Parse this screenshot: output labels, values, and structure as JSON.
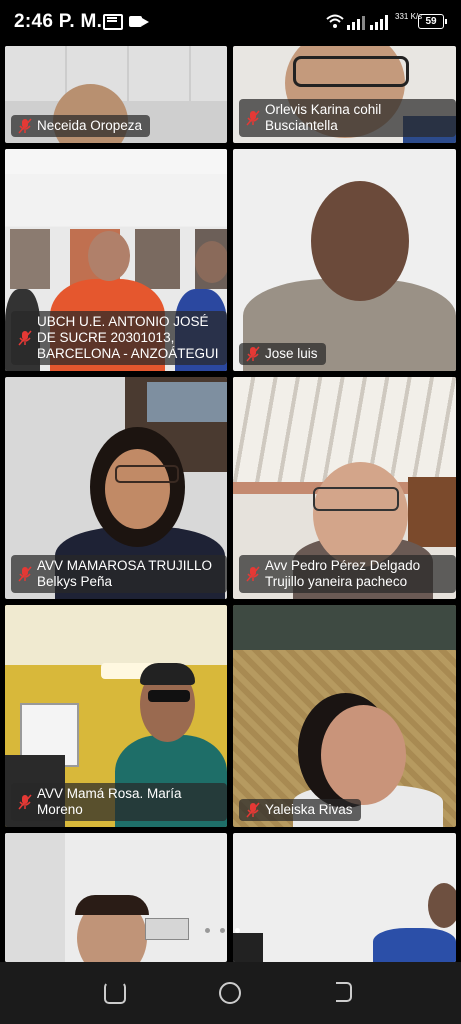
{
  "status_bar": {
    "time": "2:46 P. M.",
    "network_speed": "331 K/s",
    "battery": "59"
  },
  "participants": [
    {
      "name": "Neceida Oropeza",
      "muted": true
    },
    {
      "name": "Orlevis Karina cohil Busciantella",
      "muted": true
    },
    {
      "name": "UBCH U.E. ANTONIO JOSÉ DE SUCRE 20301013, BARCELONA - ANZOÁTEGUI",
      "muted": true
    },
    {
      "name": "Jose luis",
      "muted": true
    },
    {
      "name": "AVV MAMAROSA TRUJILLO Belkys Peña",
      "muted": true
    },
    {
      "name": "Avv Pedro Pérez Delgado Trujillo yaneira pacheco",
      "muted": true
    },
    {
      "name": "AVV Mamá Rosa. María Moreno",
      "muted": true
    },
    {
      "name": "Yaleiska Rivas",
      "muted": true
    },
    {
      "name": "",
      "muted": false
    },
    {
      "name": "",
      "muted": false
    }
  ],
  "pagination": {
    "pages": 3,
    "current": 2
  },
  "colors": {
    "background": "#000000",
    "label_bg": "#282828",
    "mic_muted": "#e53935"
  }
}
